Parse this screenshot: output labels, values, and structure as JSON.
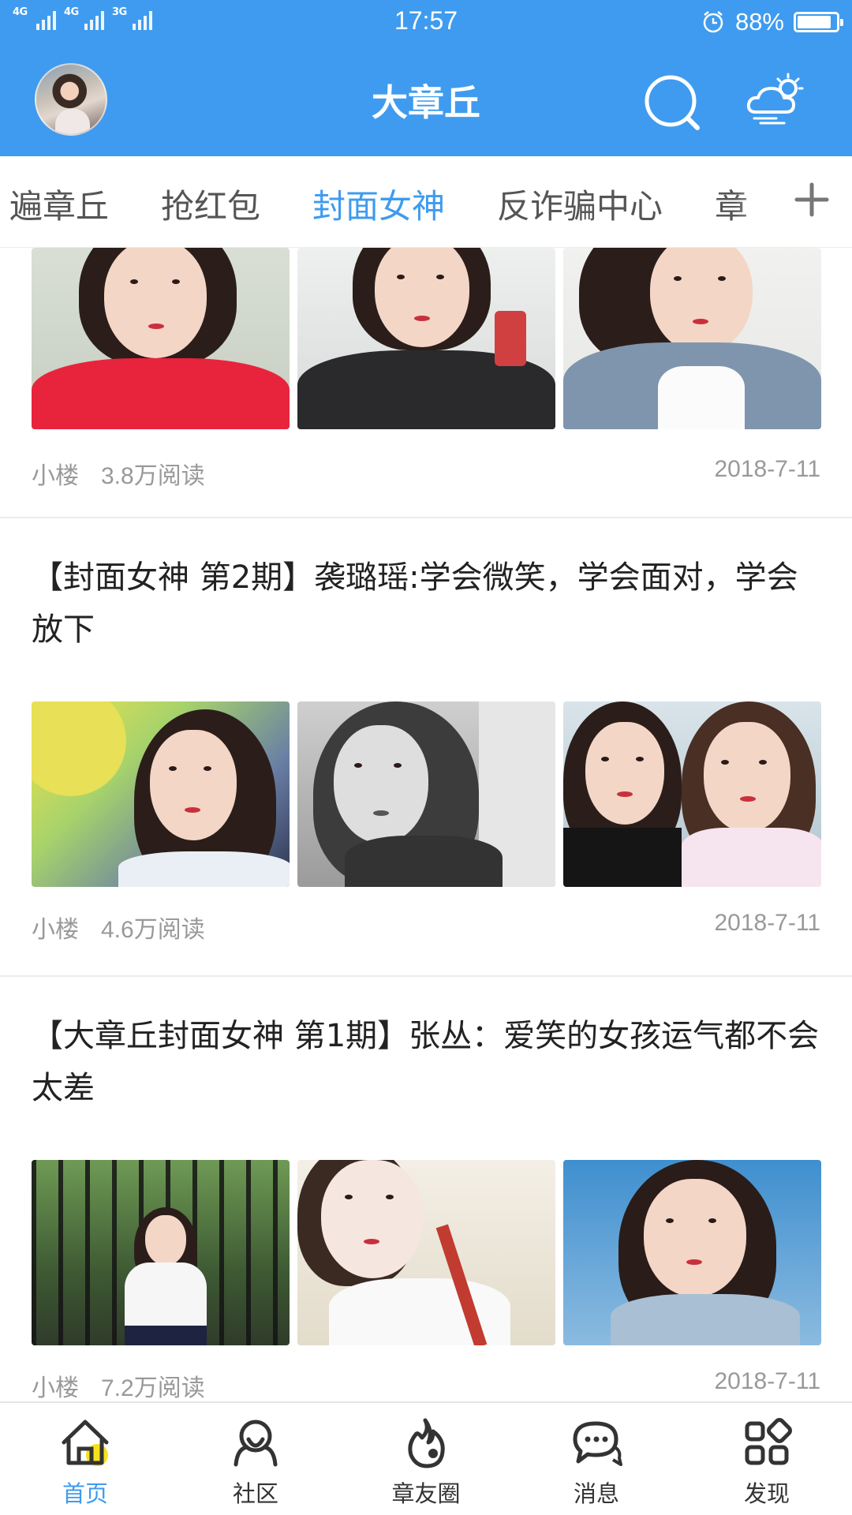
{
  "status_bar": {
    "network_1": "4G",
    "network_2": "4G",
    "network_3": "3G",
    "time": "17:57",
    "battery_percent": "88%",
    "battery_level": 0.88
  },
  "header": {
    "title": "大章丘",
    "accent_color": "#3f9bef"
  },
  "tabs": {
    "items": [
      "遍章丘",
      "抢红包",
      "封面女神",
      "反诈骗中心",
      "章"
    ],
    "active": "封面女神"
  },
  "feed": {
    "articles": [
      {
        "author": "小楼",
        "reads": "3.8万阅读",
        "date": "2018-7-11"
      },
      {
        "title": "【封面女神 第2期】袭璐瑶:学会微笑，学会面对，学会放下",
        "author": "小楼",
        "reads": "4.6万阅读",
        "date": "2018-7-11"
      },
      {
        "title": "【大章丘封面女神 第1期】张丛：爱笑的女孩运气都不会太差",
        "author": "小楼",
        "reads": "7.2万阅读",
        "date": "2018-7-11"
      }
    ]
  },
  "bottom_nav": {
    "items": [
      {
        "label": "首页",
        "icon": "home-icon",
        "active": true
      },
      {
        "label": "社区",
        "icon": "community-icon",
        "active": false
      },
      {
        "label": "章友圈",
        "icon": "flame-icon",
        "active": false
      },
      {
        "label": "消息",
        "icon": "message-icon",
        "active": false
      },
      {
        "label": "发现",
        "icon": "discover-icon",
        "active": false
      }
    ]
  }
}
